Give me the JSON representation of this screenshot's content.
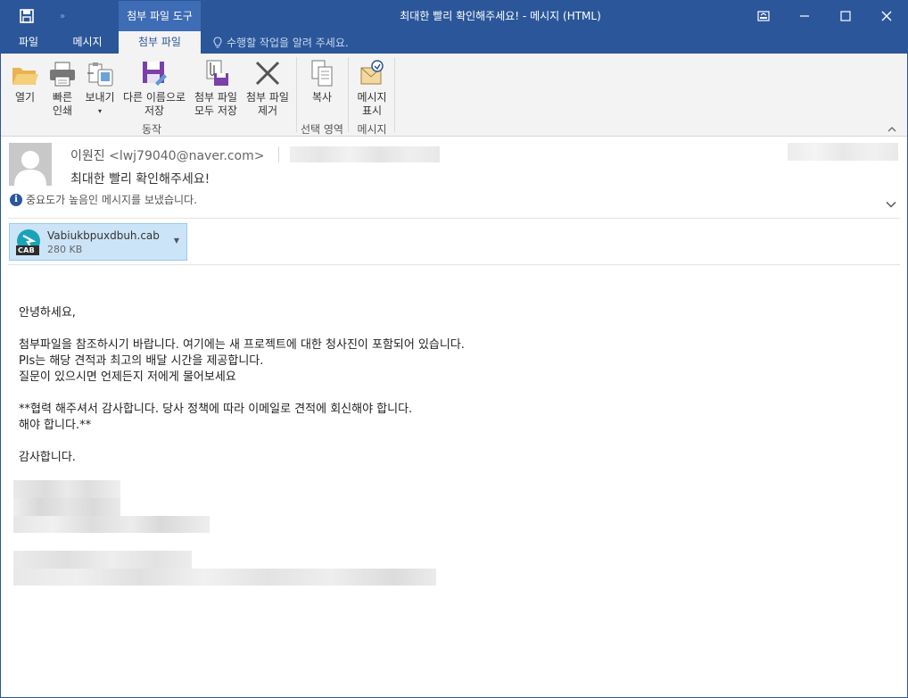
{
  "window": {
    "title": "최대한 빨리 확인해주세요! - 메시지 (HTML)",
    "context_group": "첨부 파일 도구"
  },
  "tabs": [
    {
      "label": "파일"
    },
    {
      "label": "메시지"
    },
    {
      "label": "첨부 파일"
    }
  ],
  "tell_me": "수행할 작업을 알려 주세요.",
  "ribbon": {
    "groups": [
      {
        "label": "동작"
      },
      {
        "label": "선택 영역"
      },
      {
        "label": "메시지"
      }
    ],
    "buttons": [
      {
        "line1": "열기",
        "line2": "",
        "icon": "folder-open-icon"
      },
      {
        "line1": "빠른",
        "line2": "인쇄",
        "icon": "printer-icon"
      },
      {
        "line1": "보내기",
        "line2": "▾",
        "icon": "send-to-icon"
      },
      {
        "line1": "다른 이름으로",
        "line2": "저장",
        "icon": "save-as-icon"
      },
      {
        "line1": "첨부 파일",
        "line2": "모두 저장",
        "icon": "save-all-attachments-icon"
      },
      {
        "line1": "첨부 파일",
        "line2": "제거",
        "icon": "remove-attachment-icon"
      },
      {
        "line1": "복사",
        "line2": "",
        "icon": "copy-icon"
      },
      {
        "line1": "메시지",
        "line2": "표시",
        "icon": "show-message-icon"
      }
    ]
  },
  "message": {
    "sender_name": "이원진",
    "sender_email": "<lwj79040@naver.com>",
    "subject": "최대한 빨리 확인해주세요!",
    "importance_note": "중요도가 높음인 메시지를 보냈습니다."
  },
  "attachment": {
    "name": "Vabiukbpuxdbuh.cab",
    "size": "280 KB",
    "type_badge": "CAB"
  },
  "body": {
    "greeting": "안녕하세요,",
    "line1": "첨부파일을 참조하시기 바랍니다. 여기에는 새 프로젝트에 대한 청사진이 포함되어 있습니다.",
    "line2": "Pls는 해당 견적과 최고의 배달 시간을 제공합니다.",
    "line3": "질문이 있으시면 언제든지 저에게 물어보세요",
    "line4": "**협력 해주셔서 감사합니다. 당사 정책에 따라 이메일로 견적에 회신해야 합니다.",
    "line5": "해야 합니다.**",
    "closing": "감사합니다."
  }
}
